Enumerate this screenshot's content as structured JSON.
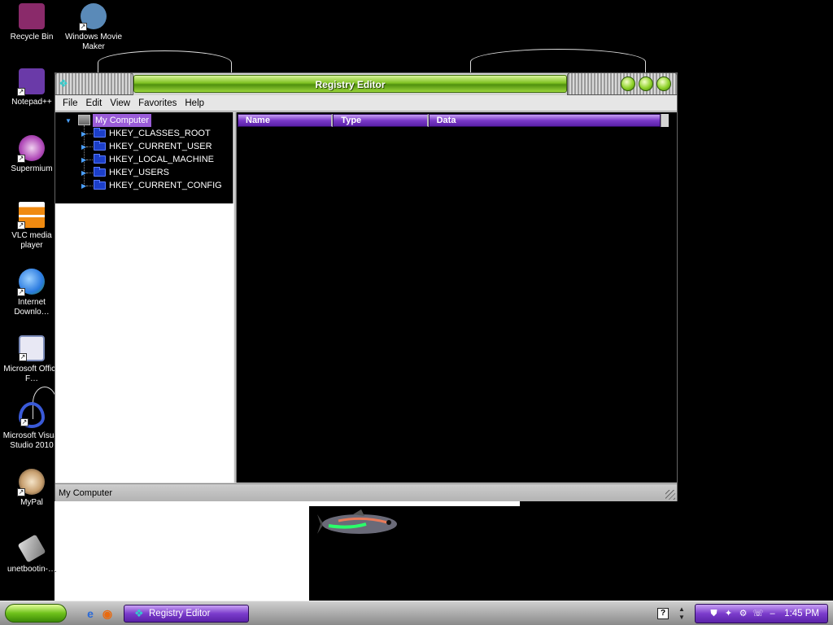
{
  "desktop": {
    "icons": [
      {
        "label": "Recycle Bin",
        "icon": "recycle-bin-icon",
        "color": "#8a2a6a"
      },
      {
        "label": "Windows Movie Maker",
        "icon": "movie-maker-icon",
        "color": "#5a8ab8"
      },
      {
        "label": "Notepad++",
        "icon": "notepad-plus-plus-icon",
        "color": "#6a3aa8"
      },
      {
        "label": "Supermium",
        "icon": "supermium-icon",
        "color": "#b04ab8"
      },
      {
        "label": "VLC media player",
        "icon": "vlc-icon",
        "color": "#f08a10"
      },
      {
        "label": "Internet Downlo…",
        "icon": "internet-download-manager-icon",
        "color": "#2a7ae0"
      },
      {
        "label": "Microsoft Office F…",
        "icon": "office-icon",
        "color": "#7a8ab8"
      },
      {
        "label": "Microsoft Visual Studio 2010",
        "icon": "visual-studio-icon",
        "color": "#3a5ad8"
      },
      {
        "label": "MyPal",
        "icon": "mypal-icon",
        "color": "#c8a070"
      },
      {
        "label": "unetbootin-…",
        "icon": "unetbootin-icon",
        "color": "#9a9a9a"
      }
    ]
  },
  "window": {
    "title": "Registry Editor",
    "menu": [
      "File",
      "Edit",
      "View",
      "Favorites",
      "Help"
    ],
    "tree": {
      "root": "My Computer",
      "keys": [
        "HKEY_CLASSES_ROOT",
        "HKEY_CURRENT_USER",
        "HKEY_LOCAL_MACHINE",
        "HKEY_USERS",
        "HKEY_CURRENT_CONFIG"
      ]
    },
    "columns": [
      "Name",
      "Type",
      "Data"
    ],
    "status": "My Computer"
  },
  "taskbar": {
    "task_label": "Registry Editor",
    "clock": "1:45 PM"
  },
  "colors": {
    "title_green": "#7fc222",
    "accent_purple": "#7a3ac8"
  }
}
